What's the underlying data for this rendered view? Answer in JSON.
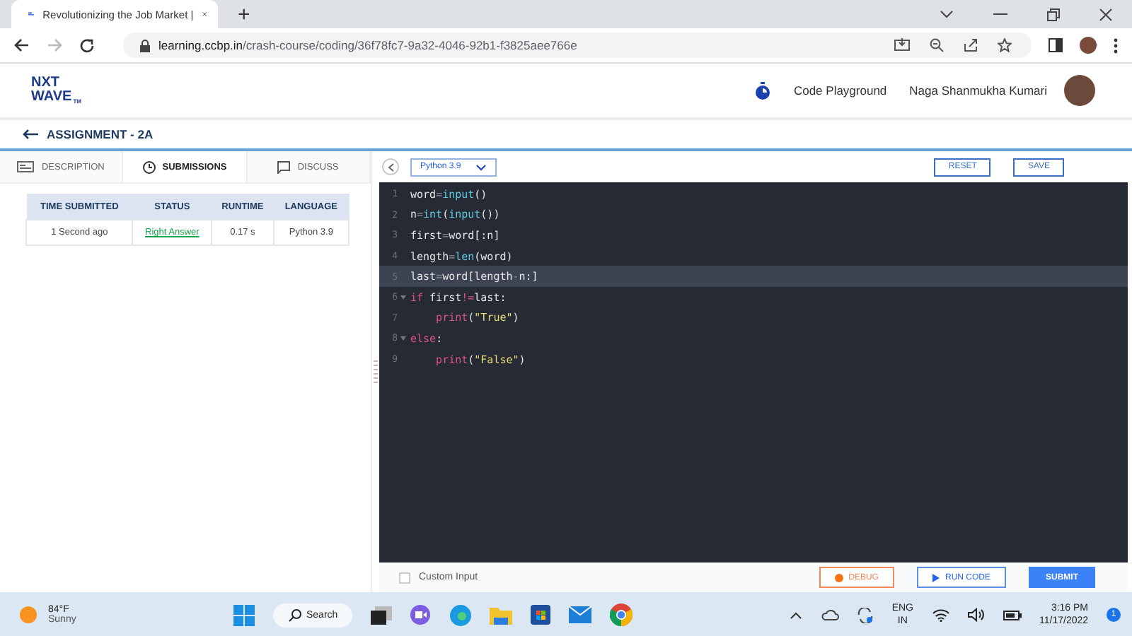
{
  "browser": {
    "tab_title": "Revolutionizing the Job Market |",
    "new_tab": "+",
    "url_host": "learning.ccbp.in",
    "url_path": "/crash-course/coding/36f78fc7-9a32-4046-92b1-f3825aee766e"
  },
  "header": {
    "logo_top": "NXT",
    "logo_bottom": "WAVE",
    "logo_tm": "TM",
    "playground": "Code Playground",
    "user": "Naga Shanmukha Kumari"
  },
  "assignment": {
    "title": "ASSIGNMENT - 2A"
  },
  "tabs": [
    {
      "label": "DESCRIPTION",
      "kind": "doc",
      "selected": false
    },
    {
      "label": "SUBMISSIONS",
      "kind": "clock",
      "selected": true
    },
    {
      "label": "DISCUSS",
      "kind": "chat",
      "selected": false
    }
  ],
  "table": {
    "columns": [
      "TIME SUBMITTED",
      "STATUS",
      "RUNTIME",
      "LANGUAGE"
    ],
    "rows": [
      {
        "cells": [
          "1 Second ago",
          "Right Answer",
          "0.17 s",
          "Python 3.9"
        ]
      }
    ]
  },
  "editor": {
    "language": "Python 3.9",
    "reset": "RESET",
    "save": "SAVE",
    "lines": [
      {
        "number": "1",
        "foldable": false,
        "active": false,
        "tokens": [
          {
            "kind": "name",
            "text": "word"
          },
          {
            "kind": "op",
            "text": "="
          },
          {
            "kind": "builtin",
            "text": "input"
          },
          {
            "kind": "name",
            "text": "()"
          }
        ]
      },
      {
        "number": "2",
        "foldable": false,
        "active": false,
        "tokens": [
          {
            "kind": "name",
            "text": "n"
          },
          {
            "kind": "op",
            "text": "="
          },
          {
            "kind": "builtin",
            "text": "int"
          },
          {
            "kind": "name",
            "text": "("
          },
          {
            "kind": "builtin",
            "text": "input"
          },
          {
            "kind": "name",
            "text": "())"
          }
        ]
      },
      {
        "number": "3",
        "foldable": false,
        "active": false,
        "tokens": [
          {
            "kind": "name",
            "text": "first"
          },
          {
            "kind": "op",
            "text": "="
          },
          {
            "kind": "name",
            "text": "word[:n]"
          }
        ]
      },
      {
        "number": "4",
        "foldable": false,
        "active": false,
        "tokens": [
          {
            "kind": "name",
            "text": "length"
          },
          {
            "kind": "op",
            "text": "="
          },
          {
            "kind": "builtin",
            "text": "len"
          },
          {
            "kind": "name",
            "text": "(word)"
          }
        ]
      },
      {
        "number": "5",
        "foldable": false,
        "active": true,
        "tokens": [
          {
            "kind": "name",
            "text": "last"
          },
          {
            "kind": "op",
            "text": "="
          },
          {
            "kind": "name",
            "text": "word[length"
          },
          {
            "kind": "op",
            "text": "-"
          },
          {
            "kind": "name",
            "text": "n:]"
          }
        ]
      },
      {
        "number": "6",
        "foldable": true,
        "active": false,
        "tokens": [
          {
            "kind": "keyword",
            "text": "if"
          },
          {
            "kind": "name",
            "text": " first"
          },
          {
            "kind": "keyword",
            "text": "!="
          },
          {
            "kind": "name",
            "text": "last:"
          }
        ]
      },
      {
        "number": "7",
        "foldable": false,
        "active": false,
        "tokens": [
          {
            "kind": "keyword",
            "text": "    print"
          },
          {
            "kind": "name",
            "text": "("
          },
          {
            "kind": "string",
            "text": "\"True\""
          },
          {
            "kind": "name",
            "text": ")"
          }
        ]
      },
      {
        "number": "8",
        "foldable": true,
        "active": false,
        "tokens": [
          {
            "kind": "keyword",
            "text": "else"
          },
          {
            "kind": "name",
            "text": ":"
          }
        ]
      },
      {
        "number": "9",
        "foldable": false,
        "active": false,
        "tokens": [
          {
            "kind": "keyword",
            "text": "    print"
          },
          {
            "kind": "name",
            "text": "("
          },
          {
            "kind": "string",
            "text": "\"False\""
          },
          {
            "kind": "name",
            "text": ")"
          }
        ]
      }
    ],
    "custom_input": {
      "label": "Custom Input",
      "checked": false
    },
    "debug": "DEBUG",
    "run": "RUN CODE",
    "submit": "SUBMIT"
  },
  "taskbar": {
    "temperature": "84°F",
    "weather": "Sunny",
    "search": "Search",
    "lang_top": "ENG",
    "lang_bottom": "IN",
    "time": "3:16 PM",
    "date": "11/17/2022",
    "notifications": "1"
  }
}
